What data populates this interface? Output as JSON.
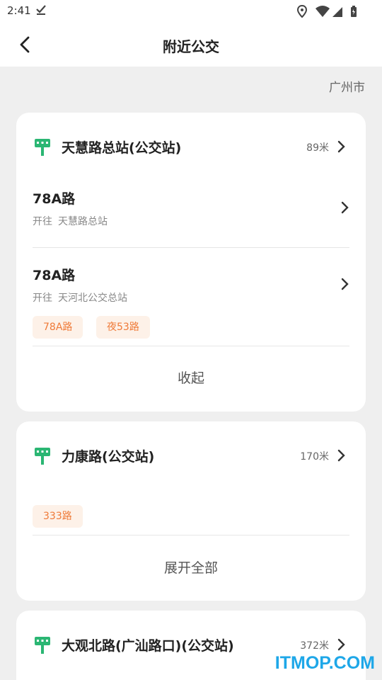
{
  "status_bar": {
    "time": "2:41",
    "icons": [
      "download-done-icon",
      "location-icon",
      "wifi-icon",
      "signal-icon",
      "battery-icon"
    ]
  },
  "header": {
    "title": "附近公交",
    "back_icon": "chevron-left-icon"
  },
  "city": "广州市",
  "colors": {
    "stop_icon_green": "#2bb673",
    "tag_bg": "#fdf1e8",
    "tag_text": "#ef7a38",
    "watermark": "#1ea7e8"
  },
  "stops": [
    {
      "name": "天慧路总站(公交站)",
      "distance": "89米",
      "routes": [
        {
          "name": "78A路",
          "dir_label": "开往",
          "destination": "天慧路总站"
        },
        {
          "name": "78A路",
          "dir_label": "开往",
          "destination": "天河北公交总站"
        }
      ],
      "tags": [
        "78A路",
        "夜53路"
      ],
      "toggle_label": "收起"
    },
    {
      "name": "力康路(公交站)",
      "distance": "170米",
      "routes": [],
      "tags": [
        "333路"
      ],
      "toggle_label": "展开全部"
    },
    {
      "name": "大观北路(广汕路口)(公交站)",
      "distance": "372米",
      "routes": [],
      "tags": []
    }
  ],
  "watermark": "ITMOP.COM"
}
